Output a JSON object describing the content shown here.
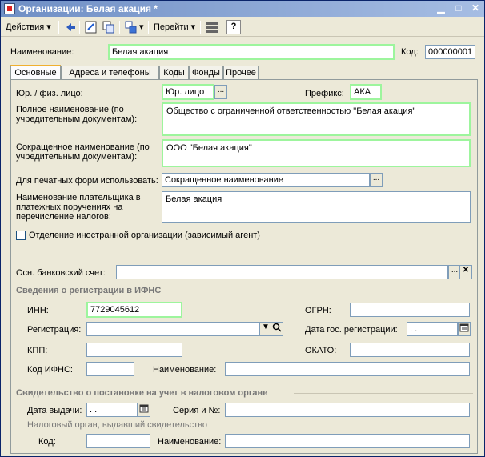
{
  "window": {
    "title": "Организации: Белая акация *"
  },
  "toolbar": {
    "actions_label": "Действия",
    "goto_label": "Перейти",
    "help_label": "?"
  },
  "header": {
    "name_label": "Наименование:",
    "name_value": "Белая акация",
    "code_label": "Код:",
    "code_value": "000000001"
  },
  "tabs": [
    "Основные",
    "Адреса и телефоны",
    "Коды",
    "Фонды",
    "Прочее"
  ],
  "main": {
    "entity_type_label": "Юр. / физ. лицо:",
    "entity_type_value": "Юр. лицо",
    "prefix_label": "Префикс:",
    "prefix_value": "АКА",
    "full_name_label": "Полное наименование (по учредительным документам):",
    "full_name_value": "Общество с ограниченной ответственностью \"Белая акация\"",
    "short_name_label": "Сокращенное наименование (по учредительным документам):",
    "short_name_value": "ООО \"Белая акация\"",
    "print_form_label": "Для печатных форм использовать:",
    "print_form_value": "Сокращенное наименование",
    "payer_name_label": "Наименование плательщика в платежных поручениях на перечисление налогов:",
    "payer_name_value": "Белая акация",
    "foreign_branch_label": "Отделение иностранной организации (зависимый агент)",
    "bank_account_label": "Осн. банковский счет:",
    "bank_account_value": ""
  },
  "ifns": {
    "title": "Сведения о регистрации в ИФНС",
    "inn_label": "ИНН:",
    "inn_value": "7729045612",
    "ogrn_label": "ОГРН:",
    "ogrn_value": "",
    "registration_label": "Регистрация:",
    "registration_value": "",
    "reg_date_label": "Дата гос. регистрации:",
    "reg_date_value": " .  .",
    "kpp_label": "КПП:",
    "kpp_value": "",
    "okato_label": "ОКАТО:",
    "okato_value": "",
    "ifns_code_label": "Код ИФНС:",
    "ifns_code_value": "",
    "name_label": "Наименование:",
    "name_value": ""
  },
  "certificate": {
    "title": "Свидетельство о постановке на учет в налоговом органе",
    "issue_date_label": "Дата выдачи:",
    "issue_date_value": " .  .",
    "series_label": "Серия и №:",
    "series_value": "",
    "issuer_label": "Налоговый орган, выдавший свидетельство",
    "code_label": "Код:",
    "code_value": "",
    "name_label": "Наименование:",
    "name_value": ""
  }
}
